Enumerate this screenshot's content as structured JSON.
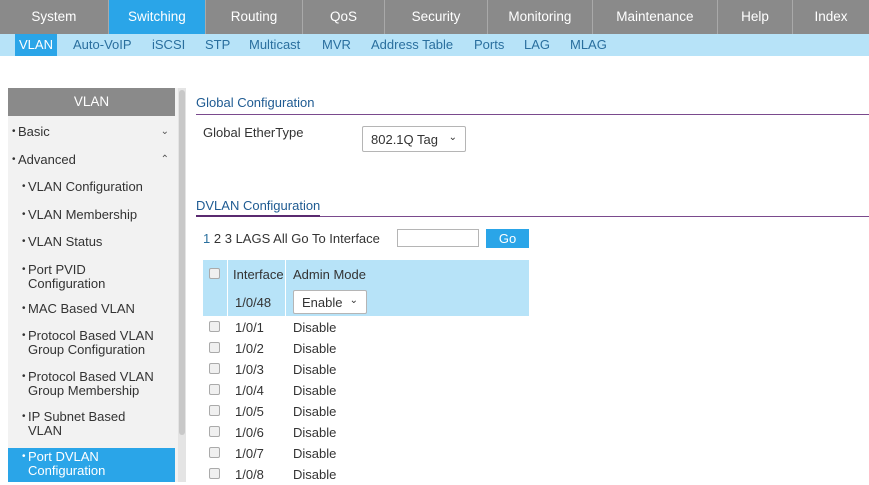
{
  "top_nav": [
    "System",
    "Switching",
    "Routing",
    "QoS",
    "Security",
    "Monitoring",
    "Maintenance",
    "Help",
    "Index"
  ],
  "top_nav_active": "Switching",
  "sub_nav": [
    "VLAN",
    "Auto-VoIP",
    "iSCSI",
    "STP",
    "Multicast",
    "MVR",
    "Address Table",
    "Ports",
    "LAG",
    "MLAG"
  ],
  "sub_nav_active": "VLAN",
  "sidebar": {
    "title": "VLAN",
    "basic": "Basic",
    "advanced": "Advanced",
    "items": [
      "VLAN Configuration",
      "VLAN Membership",
      "VLAN Status",
      "Port PVID Configuration",
      "MAC Based VLAN",
      "Protocol Based VLAN Group Configuration",
      "Protocol Based VLAN Group Membership",
      "IP Subnet Based VLAN",
      "Port DVLAN Configuration"
    ],
    "items_lines": [
      [
        "VLAN Configuration"
      ],
      [
        "VLAN Membership"
      ],
      [
        "VLAN Status"
      ],
      [
        "Port PVID",
        "Configuration"
      ],
      [
        "MAC Based VLAN"
      ],
      [
        "Protocol Based VLAN",
        "Group Configuration"
      ],
      [
        "Protocol Based VLAN",
        "Group Membership"
      ],
      [
        "IP Subnet Based",
        "VLAN"
      ],
      [
        "Port DVLAN",
        "Configuration"
      ]
    ],
    "active_item": "Port DVLAN Configuration"
  },
  "global_config": {
    "title": "Global Configuration",
    "ethertype_label": "Global EtherType",
    "ethertype_value": "802.1Q Tag"
  },
  "dvlan_config": {
    "title": "DVLAN Configuration",
    "pages": [
      "1",
      "2",
      "3",
      "LAGS",
      "All"
    ],
    "current_page": "1",
    "goto_label": "Go To Interface",
    "goto_value": "",
    "go_button": "Go",
    "columns": [
      "Interface",
      "Admin Mode"
    ],
    "edit_row": {
      "interface": "1/0/48",
      "admin_mode": "Enable"
    },
    "rows": [
      {
        "interface": "1/0/1",
        "admin_mode": "Disable"
      },
      {
        "interface": "1/0/2",
        "admin_mode": "Disable"
      },
      {
        "interface": "1/0/3",
        "admin_mode": "Disable"
      },
      {
        "interface": "1/0/4",
        "admin_mode": "Disable"
      },
      {
        "interface": "1/0/5",
        "admin_mode": "Disable"
      },
      {
        "interface": "1/0/6",
        "admin_mode": "Disable"
      },
      {
        "interface": "1/0/7",
        "admin_mode": "Disable"
      },
      {
        "interface": "1/0/8",
        "admin_mode": "Disable"
      }
    ]
  },
  "colors": {
    "nav_gray": "#8a8a8a",
    "accent_blue": "#2aa5e8",
    "light_blue": "#b7e3f8",
    "section_line": "#7a4a8d",
    "title_blue": "#1f5b92"
  }
}
